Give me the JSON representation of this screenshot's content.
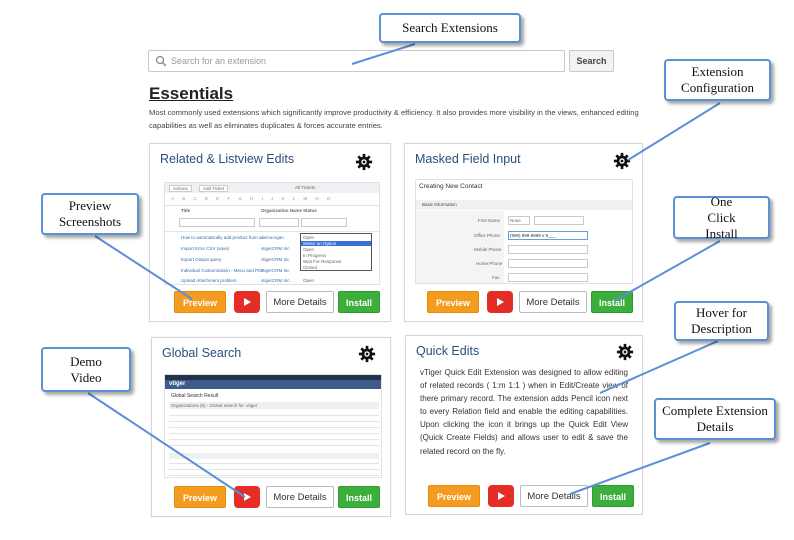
{
  "search": {
    "placeholder": "Search for an extension",
    "button_label": "Search"
  },
  "essentials": {
    "title": "Essentials",
    "description": "Most commonly used extensions which significantly improve productivity & efficiency. It also provides more visibility in the views, enhanced editing capabilities as well as eliminates duplicates  & forces accurate entries."
  },
  "buttons": {
    "preview": "Preview",
    "more_details": "More Details",
    "install": "Install"
  },
  "cards": [
    {
      "title": "Related & Listview Edits",
      "screenshot": {
        "actions": "Actions",
        "add_ticket": "Add Ticket",
        "all_tickets": "All Tickets",
        "letters": [
          "A",
          "B",
          "C",
          "D",
          "E",
          "F",
          "G",
          "H",
          "I",
          "J",
          "K",
          "L",
          "M",
          "N",
          "O"
        ],
        "col_title": "Title",
        "col_org": "Organization Name",
        "col_status": "Status",
        "rows": [
          {
            "title": "How to automatically add product from a...",
            "org": "demoorgan",
            "status": "Open"
          },
          {
            "title": "Import Error CSV (save)",
            "org": "vtigerCRM Inc",
            "status": "Select an Option"
          },
          {
            "title": "Export Output query",
            "org": "vtigerCRM Inc",
            "status": "Open"
          },
          {
            "title": "Individual Customization - Menu and PIO",
            "org": "vtigerCRM Inc",
            "status": "In Progress"
          },
          {
            "title": "Upload Attachment problem",
            "org": "vtigerCRM Inc",
            "status": "Open"
          }
        ],
        "dropdown": [
          "Select an Option",
          "Open",
          "In Progress",
          "Wait For Response",
          "Closed"
        ]
      }
    },
    {
      "title": "Masked Field Input",
      "screenshot": {
        "heading": "Creating New Contact",
        "section": "Basic Information",
        "fields": [
          {
            "label": "First Name",
            "value": "None"
          },
          {
            "label": "Office Phone",
            "value": "(999) 999-9999 x 9___"
          },
          {
            "label": "Mobile Phone",
            "value": ""
          },
          {
            "label": "Home Phone",
            "value": ""
          },
          {
            "label": "Fax",
            "value": ""
          }
        ]
      }
    },
    {
      "title": "Global Search",
      "screenshot": {
        "logo": "vtiger",
        "heading": "Global Search Result",
        "subheading": "Organizations (5) - Global search for: vtiger"
      }
    },
    {
      "title": "Quick Edits",
      "text": "vTiger Quick Edit Extension was designed to allow editing of related records ( 1:m  1:1 ) when in Edit/Create view of there primary record. The extension adds Pencil icon next to every Relation field and enable the editing capabilities. Upon clicking the icon it brings up the Quick Edit View (Quick Create Fields) and allows user to edit & save the related record on the fly."
    }
  ],
  "callouts": {
    "search_extensions": "Search Extensions",
    "extension_configuration": "Extension Configuration",
    "preview_screenshots": "Preview Screenshots",
    "one_click_install": "One Click Install",
    "hover_for_description": "Hover for Description",
    "demo_video": "Demo Video",
    "complete_extension_details": "Complete Extension Details"
  },
  "colors": {
    "callout_border": "#5b8fd6",
    "card_title": "#2a4f7b",
    "preview_orange": "#f39c1f",
    "install_green": "#3cae3c",
    "youtube_red": "#e52d27"
  },
  "icons": [
    "search-icon",
    "gear-icon",
    "youtube-play-icon"
  ]
}
